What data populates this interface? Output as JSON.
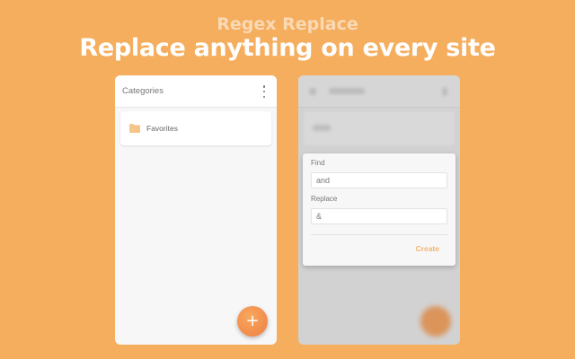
{
  "promo": {
    "subtitle": "Regex Replace",
    "title": "Replace anything on every site"
  },
  "colors": {
    "background": "#F5AE5E",
    "accent": "#EE7F45",
    "folder": "#F5C58A",
    "create_text": "#F3B66E"
  },
  "left_screen": {
    "header_title": "Categories",
    "menu_icon": "more-vertical-icon",
    "categories": [
      {
        "label": "Favorites",
        "icon": "folder-icon"
      }
    ],
    "fab_label": "+"
  },
  "right_screen": {
    "dialog": {
      "find_label": "Find",
      "find_value": "and",
      "replace_label": "Replace",
      "replace_value": "&",
      "create_label": "Create"
    }
  }
}
